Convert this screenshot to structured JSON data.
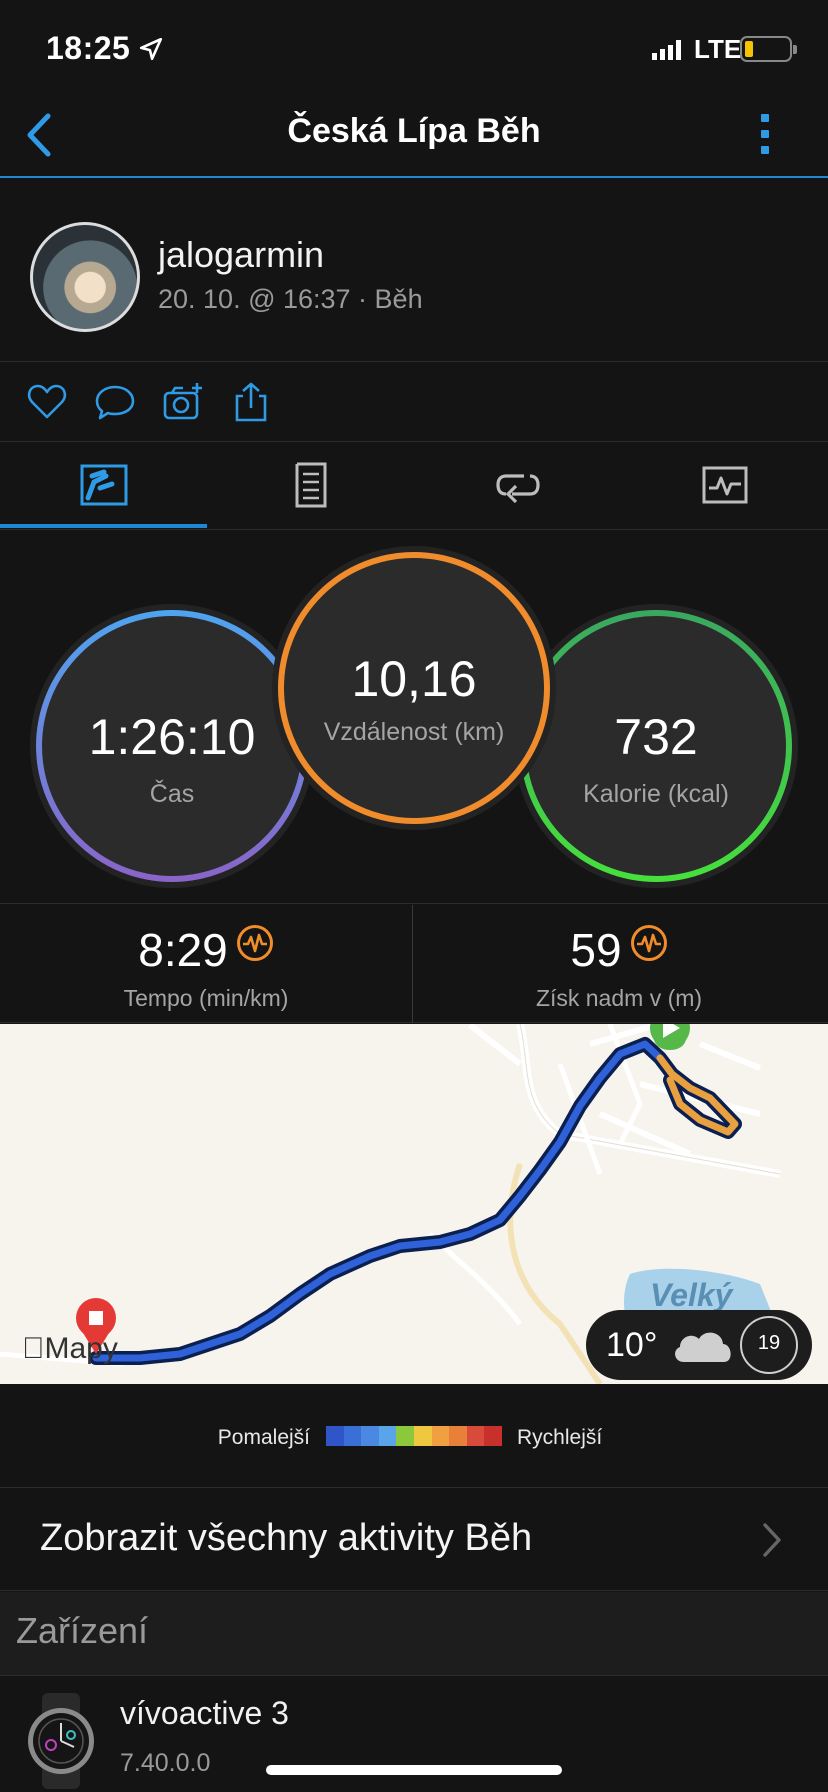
{
  "status_bar": {
    "time": "18:25",
    "network": "LTE"
  },
  "nav": {
    "title": "Česká Lípa Běh"
  },
  "user": {
    "name": "jalogarmin",
    "subtitle": "20. 10. @ 16:37 · Běh"
  },
  "social": [
    "heart-icon",
    "comment-icon",
    "camera-add-icon",
    "share-icon"
  ],
  "tabs": [
    "tab-overview",
    "tab-details",
    "tab-laps",
    "tab-charts"
  ],
  "stats": {
    "time": {
      "value": "1:26:10",
      "label": "Čas"
    },
    "distance": {
      "value": "10,16",
      "label": "Vzdálenost (km)"
    },
    "calories": {
      "value": "732",
      "label": "Kalorie (kcal)"
    }
  },
  "secondary": {
    "pace": {
      "value": "8:29",
      "label": "Tempo (min/km)"
    },
    "elevation": {
      "value": "59",
      "label": "Získ nadm v (m)"
    }
  },
  "map": {
    "provider": "Mapy",
    "place_label": "Velký",
    "weather": {
      "temp": "10°",
      "uv": "19"
    }
  },
  "legend": {
    "slower": "Pomalejší",
    "faster": "Rychlejší",
    "colors": [
      "#2f55c8",
      "#3a6fd8",
      "#4a88e2",
      "#5aa4ea",
      "#8cc83c",
      "#f0c840",
      "#f0a040",
      "#e8803a",
      "#d84a3a",
      "#c8302c"
    ]
  },
  "all_activities": {
    "label": "Zobrazit všechny aktivity Běh"
  },
  "device_section": {
    "title": "Zařízení"
  },
  "device": {
    "name": "vívoactive 3",
    "version": "7.40.0.0"
  }
}
